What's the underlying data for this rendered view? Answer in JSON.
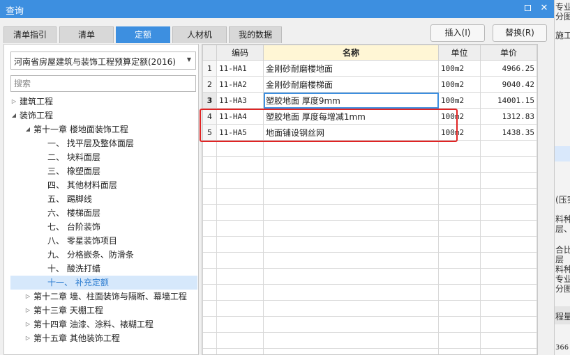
{
  "window": {
    "title": "查询",
    "max_icon": "maximize-icon",
    "close_label": "✕"
  },
  "tabs": [
    {
      "label": "清单指引",
      "active": false
    },
    {
      "label": "清单",
      "active": false
    },
    {
      "label": "定额",
      "active": true
    },
    {
      "label": "人材机",
      "active": false
    },
    {
      "label": "我的数据",
      "active": false
    }
  ],
  "buttons": {
    "insert": "插入(I)",
    "replace": "替换(R)"
  },
  "quota_select": {
    "value": "河南省房屋建筑与装饰工程预算定额(2016)"
  },
  "search": {
    "placeholder": "搜索"
  },
  "tree": [
    {
      "label": "建筑工程",
      "level": 0,
      "toggle": "▷"
    },
    {
      "label": "装饰工程",
      "level": 0,
      "toggle": "◢"
    },
    {
      "label": "第十一章 楼地面装饰工程",
      "level": 1,
      "toggle": "◢"
    },
    {
      "label": "一、 找平层及整体面层",
      "level": 2,
      "toggle": ""
    },
    {
      "label": "二、 块料面层",
      "level": 2,
      "toggle": ""
    },
    {
      "label": "三、 橡塑面层",
      "level": 2,
      "toggle": ""
    },
    {
      "label": "四、 其他材料面层",
      "level": 2,
      "toggle": ""
    },
    {
      "label": "五、 踢脚线",
      "level": 2,
      "toggle": ""
    },
    {
      "label": "六、 楼梯面层",
      "level": 2,
      "toggle": ""
    },
    {
      "label": "七、 台阶装饰",
      "level": 2,
      "toggle": ""
    },
    {
      "label": "八、 零星装饰项目",
      "level": 2,
      "toggle": ""
    },
    {
      "label": "九、 分格嵌条、防滑条",
      "level": 2,
      "toggle": ""
    },
    {
      "label": "十、 酸洗打蜡",
      "level": 2,
      "toggle": ""
    },
    {
      "label": "十一、 补充定额",
      "level": 2,
      "toggle": "",
      "selected": true
    },
    {
      "label": "第十二章 墙、柱面装饰与隔断、幕墙工程",
      "level": 1,
      "toggle": "▷"
    },
    {
      "label": "第十三章 天棚工程",
      "level": 1,
      "toggle": "▷"
    },
    {
      "label": "第十四章 油漆、涂料、裱糊工程",
      "level": 1,
      "toggle": "▷"
    },
    {
      "label": "第十五章 其他装饰工程",
      "level": 1,
      "toggle": "▷"
    }
  ],
  "grid": {
    "headers": {
      "no": "",
      "code": "编码",
      "name": "名称",
      "unit": "单位",
      "price": "单价"
    },
    "rows": [
      {
        "no": "1",
        "code": "11-HA1",
        "name": "金刚砂耐磨楼地面",
        "unit": "100m2",
        "price": "4966.25"
      },
      {
        "no": "2",
        "code": "11-HA2",
        "name": "金刚砂耐磨楼梯面",
        "unit": "100m2",
        "price": "9040.42"
      },
      {
        "no": "3",
        "code": "11-HA3",
        "name": "塑胶地面 厚度9mm",
        "unit": "100m2",
        "price": "14001.15",
        "current": true
      },
      {
        "no": "4",
        "code": "11-HA4",
        "name": "塑胶地面 厚度每增减1mm",
        "unit": "100m2",
        "price": "1312.83"
      },
      {
        "no": "5",
        "code": "11-HA5",
        "name": "地面铺设钢丝网",
        "unit": "100m2",
        "price": "1438.35"
      }
    ]
  },
  "background_edge": {
    "lines": [
      "专业",
      "分图",
      "施工段",
      "(压实",
      "料种",
      "层、",
      "合比",
      "层",
      "料种",
      "专业",
      "分图",
      "程量",
      "366"
    ]
  },
  "colors": {
    "accent": "#3d8fe0",
    "highlight": "#e02424",
    "selected_row": "#d6e8fb"
  }
}
